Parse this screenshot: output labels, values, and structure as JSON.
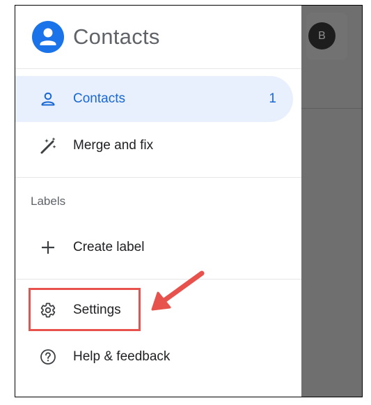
{
  "app": {
    "title": "Contacts",
    "logo_icon": "account-circle-icon",
    "accent_color": "#1a73e8"
  },
  "background": {
    "avatar_initial": "B"
  },
  "drawer": {
    "items": [
      {
        "label": "Contacts",
        "icon": "person-icon",
        "count": "1",
        "active": true
      },
      {
        "label": "Merge and fix",
        "icon": "magic-wand-icon",
        "active": false
      }
    ],
    "labels_section": {
      "heading": "Labels",
      "create_label": {
        "label": "Create label",
        "icon": "plus-icon"
      }
    },
    "footer_items": [
      {
        "label": "Settings",
        "icon": "gear-icon"
      },
      {
        "label": "Help & feedback",
        "icon": "help-circle-icon"
      }
    ]
  },
  "annotation": {
    "highlight_color": "#e8524c",
    "target": "Settings"
  }
}
